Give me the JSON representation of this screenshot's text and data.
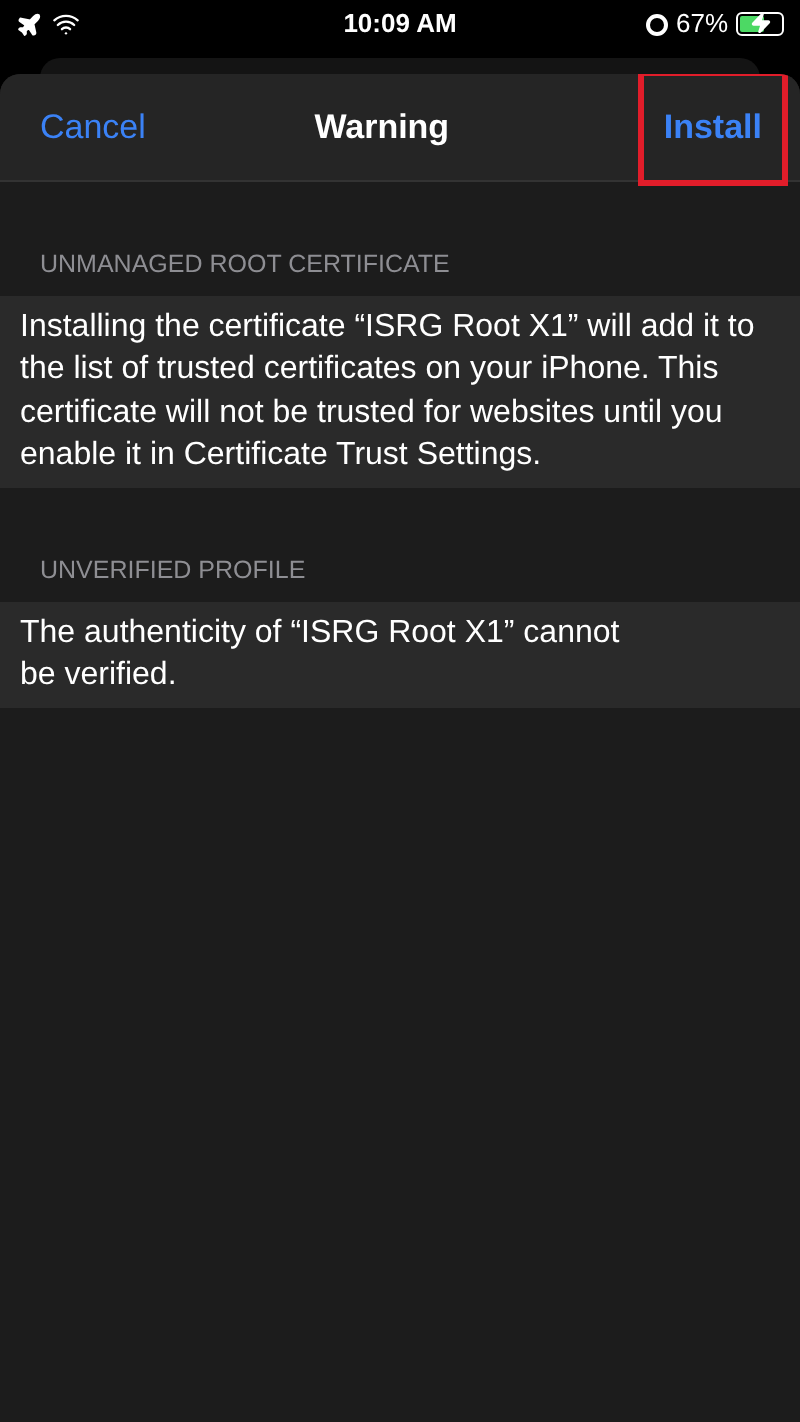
{
  "status_bar": {
    "time": "10:09 AM",
    "battery": "67%",
    "airplane_mode": true,
    "charging": true
  },
  "nav": {
    "cancel": "Cancel",
    "title": "Warning",
    "install": "Install",
    "install_highlighted": true
  },
  "sections": [
    {
      "header": "UNMANAGED ROOT CERTIFICATE",
      "text": "Installing the certificate “ISRG Root X1” will add it to the list of trusted certificates on your iPhone. This certificate will not be trusted for websites until you enable it in Certificate Trust Settings."
    },
    {
      "header": "UNVERIFIED PROFILE",
      "text": "The authenticity of “ISRG Root X1” cannot\nbe verified."
    }
  ]
}
